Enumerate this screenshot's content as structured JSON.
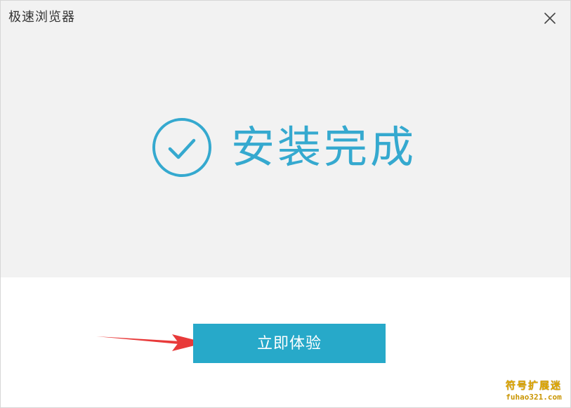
{
  "window": {
    "title": "极速浏览器",
    "close_icon": "close-icon"
  },
  "install": {
    "status_text": "安装完成",
    "status_icon": "check-circle-icon",
    "accent_color": "#35a9cf"
  },
  "actions": {
    "primary_label": "立即体验",
    "primary_color": "#27a9c9"
  },
  "annotation": {
    "arrow_icon": "red-arrow-icon",
    "arrow_color": "#e83a3a"
  },
  "watermark": {
    "main": "符号扩展迷",
    "sub": "fuhao321.com"
  }
}
